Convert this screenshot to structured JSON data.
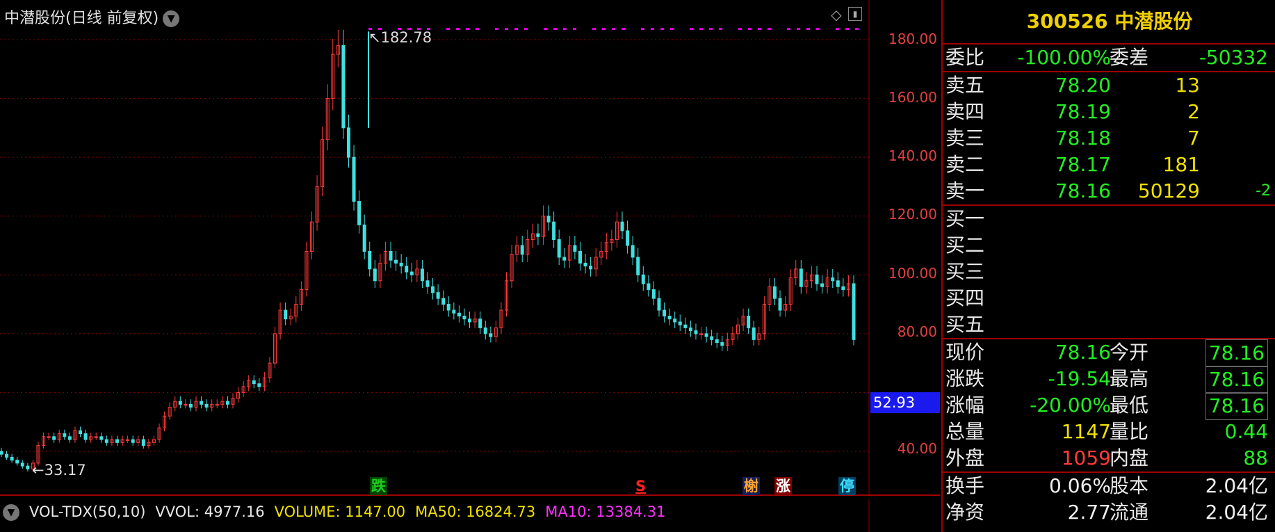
{
  "chart": {
    "title": "中潜股份(日线 前复权)",
    "price_ticks": [
      "180.00",
      "160.00",
      "140.00",
      "120.00",
      "100.00",
      "80.00",
      "40.00"
    ],
    "current_price_box": "52.93",
    "peak_label": "182.78",
    "trough_label": "33.17",
    "markers": [
      {
        "text": "跌",
        "color": "#22cc22",
        "bg": "#004400"
      },
      {
        "text": "S",
        "color": "#ff2020",
        "bg": "transparent"
      },
      {
        "text": "榭",
        "color": "#ffa030",
        "bg": "#102060"
      },
      {
        "text": "涨",
        "color": "#ffffff",
        "bg": "#800000"
      },
      {
        "text": "停",
        "color": "#40e0ff",
        "bg": "#004060"
      }
    ],
    "up_color": "#ff3b3b",
    "down_color": "#40e0e0",
    "grid_color": "#8b0000"
  },
  "volume_bar": {
    "name": "VOL-TDX(50,10)",
    "vvol": "VVOL: 4977.16",
    "volume": "VOLUME: 1147.00",
    "ma50": "MA50: 16824.73",
    "ma10": "MA10: 13384.31"
  },
  "panel": {
    "title": "300526 中潜股份",
    "weibi": {
      "label": "委比",
      "value": "-100.00%",
      "label2": "委差",
      "value2": "-50332"
    },
    "asks": [
      {
        "label": "卖五",
        "price": "78.20",
        "qty": "13",
        "chg": ""
      },
      {
        "label": "卖四",
        "price": "78.19",
        "qty": "2",
        "chg": ""
      },
      {
        "label": "卖三",
        "price": "78.18",
        "qty": "7",
        "chg": ""
      },
      {
        "label": "卖二",
        "price": "78.17",
        "qty": "181",
        "chg": ""
      },
      {
        "label": "卖一",
        "price": "78.16",
        "qty": "50129",
        "chg": "-2"
      }
    ],
    "bids": [
      "买一",
      "买二",
      "买三",
      "买四",
      "买五"
    ],
    "stats": [
      {
        "l1": "现价",
        "v1": "78.16",
        "c1": "green",
        "l2": "今开",
        "v2": "78.16",
        "c2": "green",
        "box": true
      },
      {
        "l1": "涨跌",
        "v1": "-19.54",
        "c1": "green",
        "l2": "最高",
        "v2": "78.16",
        "c2": "green",
        "box": true
      },
      {
        "l1": "涨幅",
        "v1": "-20.00%",
        "c1": "green",
        "l2": "最低",
        "v2": "78.16",
        "c2": "green",
        "box": true
      },
      {
        "l1": "总量",
        "v1": "1147",
        "c1": "yellow",
        "l2": "量比",
        "v2": "0.44",
        "c2": "green",
        "box": false
      },
      {
        "l1": "外盘",
        "v1": "1059",
        "c1": "red",
        "l2": "内盘",
        "v2": "88",
        "c2": "green",
        "box": false
      }
    ],
    "stats2": [
      {
        "l1": "换手",
        "v1": "0.06%",
        "l2": "股本",
        "v2": "2.04亿"
      },
      {
        "l1": "净资",
        "v1": "2.77",
        "l2": "流通",
        "v2": "2.04亿"
      }
    ]
  },
  "chart_data": {
    "type": "candlestick",
    "price_axis_ticks": [
      40,
      80,
      100,
      120,
      140,
      160,
      180
    ],
    "peak": 182.78,
    "trough": 33.17,
    "closes_approx": [
      39,
      38,
      37,
      36,
      35,
      34,
      36,
      42,
      45,
      45,
      44,
      46,
      45,
      44,
      47,
      46,
      44,
      45,
      45,
      44,
      43,
      44,
      43,
      44,
      44,
      43,
      44,
      42,
      43,
      44,
      48,
      52,
      55,
      57,
      56,
      56,
      55,
      57,
      56,
      55,
      56,
      56,
      57,
      56,
      58,
      60,
      62,
      64,
      63,
      62,
      65,
      70,
      80,
      88,
      85,
      86,
      90,
      95,
      108,
      118,
      130,
      146,
      160,
      175,
      178,
      150,
      140,
      125,
      117,
      108,
      102,
      98,
      104,
      108,
      105,
      104,
      103,
      101,
      100,
      102,
      98,
      96,
      94,
      92,
      90,
      88,
      87,
      86,
      85,
      84,
      85,
      82,
      80,
      79,
      82,
      88,
      98,
      107,
      110,
      107,
      112,
      114,
      113,
      120,
      118,
      112,
      106,
      105,
      110,
      108,
      104,
      103,
      102,
      106,
      108,
      111,
      112,
      118,
      115,
      110,
      106,
      100,
      97,
      95,
      92,
      88,
      86,
      85,
      84,
      83,
      82,
      81,
      80,
      80,
      79,
      78,
      77,
      76,
      78,
      80,
      83,
      86,
      82,
      78,
      80,
      90,
      96,
      92,
      88,
      90,
      99,
      102,
      96,
      98,
      100,
      97,
      96,
      99,
      98,
      96,
      95,
      97,
      78
    ]
  }
}
